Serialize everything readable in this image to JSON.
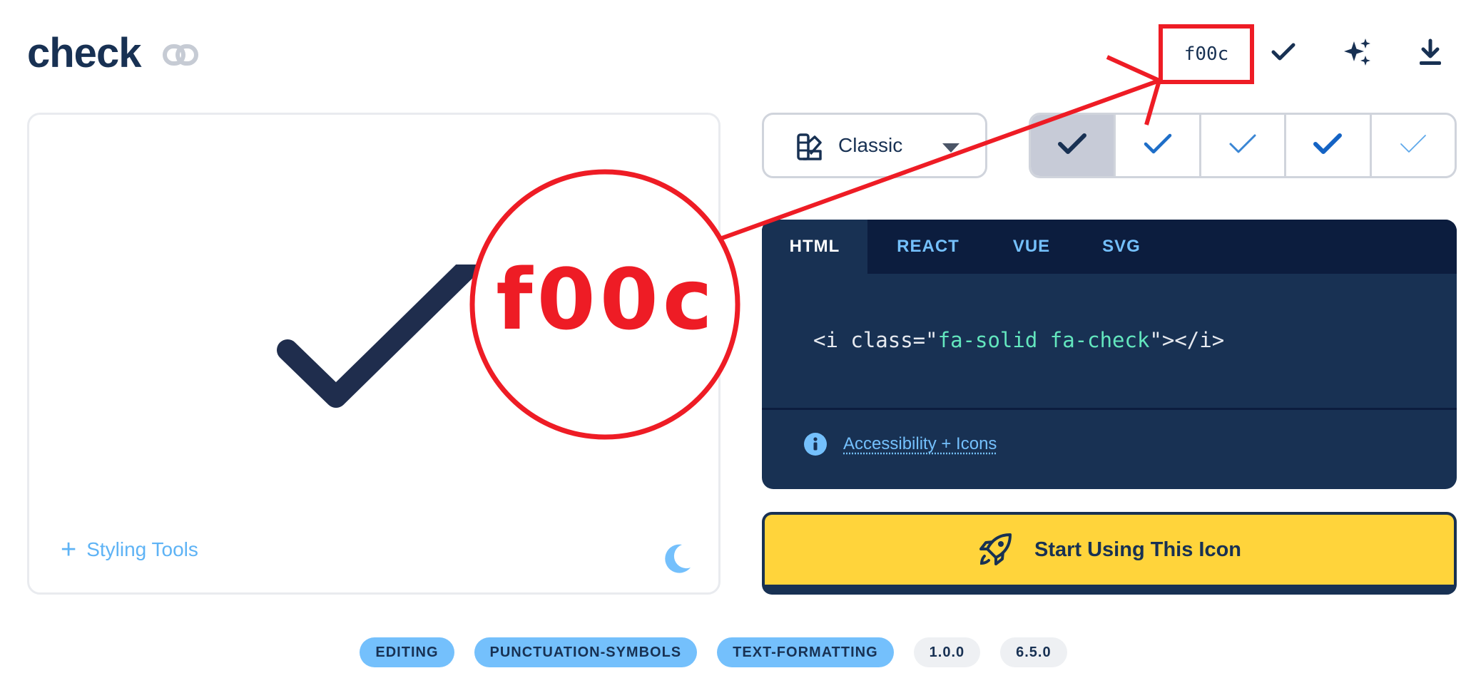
{
  "header": {
    "title": "check",
    "unicode": "f00c"
  },
  "preview": {
    "styling_tools_label": "Styling Tools"
  },
  "style_selector": {
    "selected": "Classic"
  },
  "code_panel": {
    "tabs": [
      {
        "label": "HTML",
        "active": true
      },
      {
        "label": "REACT",
        "active": false
      },
      {
        "label": "VUE",
        "active": false
      },
      {
        "label": "SVG",
        "active": false
      }
    ],
    "code": {
      "prefix": "<i class=\"",
      "value": "fa-solid fa-check",
      "suffix": "\"></i>"
    },
    "accessibility_link": "Accessibility + Icons"
  },
  "cta": {
    "label": "Start Using This Icon"
  },
  "tags": [
    "EDITING",
    "PUNCTUATION-SYMBOLS",
    "TEXT-FORMATTING"
  ],
  "versions": [
    "1.0.0",
    "6.5.0"
  ],
  "annotation": {
    "zoom_text": "f00c"
  },
  "colors": {
    "navy": "#183153",
    "accent_blue": "#74c0fc",
    "cta_yellow": "#ffd43b",
    "annotation_red": "#ee1c25"
  }
}
